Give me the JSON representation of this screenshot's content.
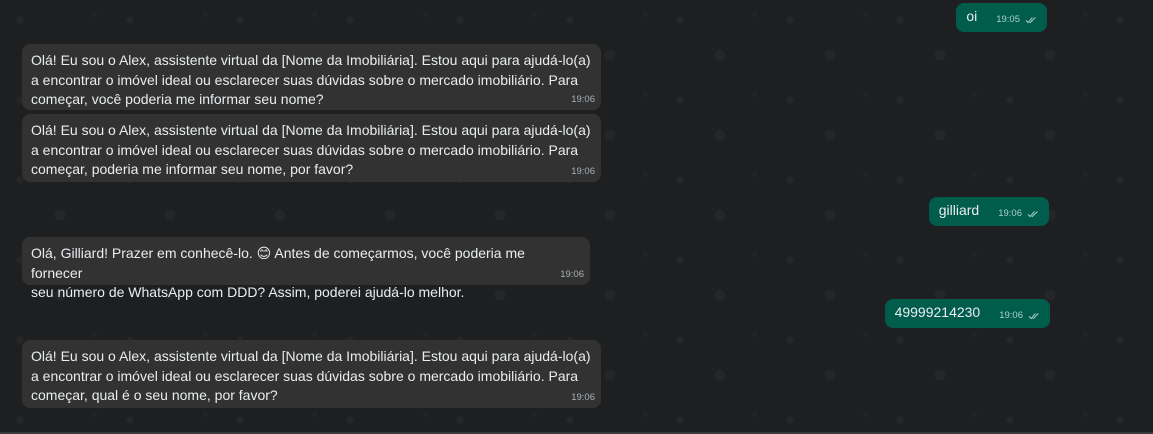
{
  "messages": [
    {
      "direction": "out",
      "text": "oi",
      "time": "19:05"
    },
    {
      "direction": "in",
      "text": "Olá! Eu sou o Alex, assistente virtual da [Nome da Imobiliária]. Estou aqui para ajudá-lo(a)\na encontrar o imóvel ideal ou esclarecer suas dúvidas sobre o mercado imobiliário. Para\ncomeçar, você poderia me informar seu nome?",
      "time": "19:06"
    },
    {
      "direction": "in",
      "text": "Olá! Eu sou o Alex, assistente virtual da [Nome da Imobiliária]. Estou aqui para ajudá-lo(a)\na encontrar o imóvel ideal ou esclarecer suas dúvidas sobre o mercado imobiliário. Para\ncomeçar, poderia me informar seu nome, por favor?",
      "time": "19:06"
    },
    {
      "direction": "out",
      "text": "gilliard",
      "time": "19:06"
    },
    {
      "direction": "in",
      "text": "Olá, Gilliard! Prazer em conhecê-lo. 😊 Antes de começarmos, você poderia me fornecer\nseu número de WhatsApp com DDD? Assim, poderei ajudá-lo melhor.",
      "time": "19:06"
    },
    {
      "direction": "out",
      "text": "49999214230",
      "time": "19:06"
    },
    {
      "direction": "in",
      "text": "Olá! Eu sou o Alex, assistente virtual da [Nome da Imobiliária]. Estou aqui para ajudá-lo(a)\na encontrar o imóvel ideal ou esclarecer suas dúvidas sobre o mercado imobiliário. Para\ncomeçar, qual é o seu nome, por favor?",
      "time": "19:06"
    }
  ],
  "status": {
    "read_receipt_icon": "double-check-icon"
  },
  "colors": {
    "background": "#1e1f20",
    "incoming_bubble": "#323232",
    "outgoing_bubble": "#005c4b",
    "text": "#e9edef"
  }
}
